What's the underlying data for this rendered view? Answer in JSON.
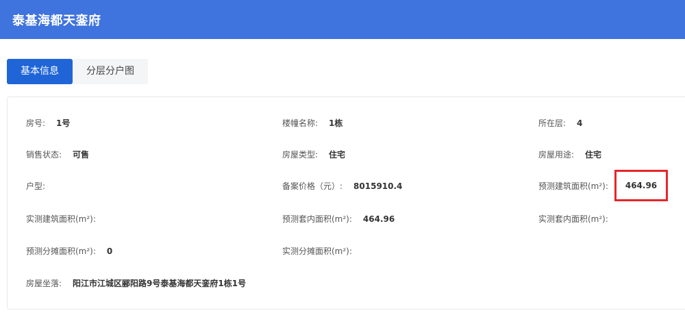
{
  "header": {
    "title": "泰基海都天銮府"
  },
  "tabs": [
    {
      "label": "基本信息",
      "active": true
    },
    {
      "label": "分层分户图",
      "active": false
    }
  ],
  "fields": {
    "room_no": {
      "label": "房号:",
      "value": "1号"
    },
    "building_name": {
      "label": "楼幢名称:",
      "value": "1栋"
    },
    "floor": {
      "label": "所在层:",
      "value": "4"
    },
    "sale_status": {
      "label": "销售状态:",
      "value": "可售"
    },
    "house_type": {
      "label": "房屋类型:",
      "value": "住宅"
    },
    "house_use": {
      "label": "房屋用途:",
      "value": "住宅"
    },
    "layout": {
      "label": "户型:",
      "value": ""
    },
    "filed_price": {
      "label": "备案价格（元）:",
      "value": "8015910.4"
    },
    "est_build_area": {
      "label": "预测建筑面积(m²):",
      "value": "464.96"
    },
    "actual_build_area": {
      "label": "实测建筑面积(m²):",
      "value": ""
    },
    "est_inner_area": {
      "label": "预测套内面积(m²):",
      "value": "464.96"
    },
    "actual_inner_area": {
      "label": "实测套内面积(m²):",
      "value": ""
    },
    "est_shared_area": {
      "label": "预测分摊面积(m²):",
      "value": "0"
    },
    "actual_shared_area": {
      "label": "实测分摊面积(m²):",
      "value": ""
    },
    "address": {
      "label": "房屋坐落:",
      "value": "阳江市江城区郦阳路9号泰基海都天銮府1栋1号"
    }
  },
  "colors": {
    "header": "#3f73dd",
    "tab_active": "#1f65d8",
    "highlight_border": "#e5252a"
  }
}
